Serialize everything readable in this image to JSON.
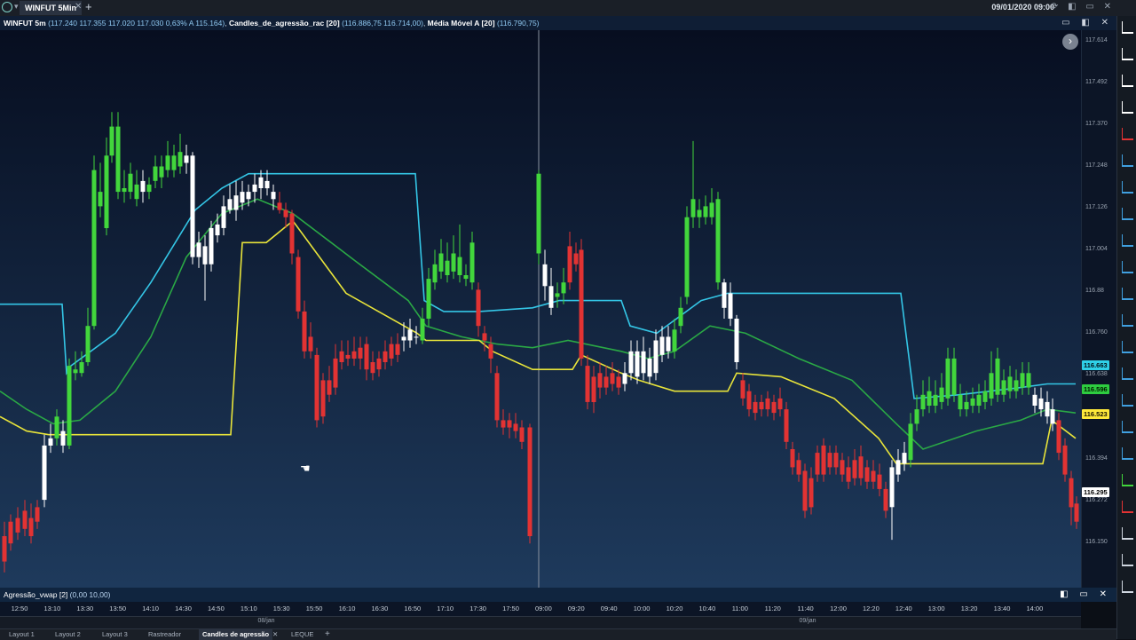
{
  "window": {
    "tab_title": "WINFUT 5Min",
    "datetime": "09/01/2020 09:00",
    "tab_close": "✕",
    "tab_add": "+"
  },
  "chart_header": {
    "symbol": "WINFUT 5m",
    "ohlc": "(117.240  117.355  117.020  117.030  0,63%  A 115.164)",
    "indicator1": "Candles_de_agressão_rac [20]",
    "indicator1_values": "(116.886,75  116.714,00)",
    "indicator2": "Média Móvel A [20]",
    "indicator2_values": "(116.790,75)"
  },
  "price_axis": {
    "ticks": [
      "117.614",
      "117.492",
      "117.370",
      "117.248",
      "117.126",
      "117.004",
      "116.88",
      "116.760",
      "116.638",
      "116.394",
      "116.272",
      "116.150"
    ],
    "badges": [
      {
        "value": "116.663",
        "color": "#2fd0e8",
        "text_color": "#001018"
      },
      {
        "value": "116.596",
        "color": "#2ecc40",
        "text_color": "#001a00"
      },
      {
        "value": "116.523",
        "color": "#ffe93a",
        "text_color": "#1a1400"
      },
      {
        "value": "116.295",
        "color": "#ffffff",
        "text_color": "#000000"
      }
    ]
  },
  "time_axis": {
    "ticks": [
      "12:50",
      "13:10",
      "13:30",
      "13:50",
      "14:10",
      "14:30",
      "14:50",
      "15:10",
      "15:30",
      "15:50",
      "16:10",
      "16:30",
      "16:50",
      "17:10",
      "17:30",
      "17:50",
      "09:00",
      "09:20",
      "09:40",
      "10:00",
      "10:20",
      "10:40",
      "11:00",
      "11:20",
      "11:40",
      "12:00",
      "12:20",
      "12:40",
      "13:00",
      "13:20",
      "13:40",
      "14:00"
    ],
    "dates": [
      "08/jan",
      "09/jan"
    ]
  },
  "sub_panel": {
    "title": "Agressão_vwap [2]",
    "values": "(0,00 10,00)"
  },
  "bottom_tabs": [
    "Layout 1",
    "Layout 2",
    "Layout 3",
    "Rastreador",
    "Candles de agressão",
    "LEQUE"
  ],
  "bottom_tab_close": "✕",
  "bottom_tab_add": "+",
  "colors": {
    "cyan_band": "#34c6e6",
    "yellow_line": "#e8e43a",
    "green_line": "#2aa845",
    "bull": "#42d63c",
    "bear": "#e23333",
    "neutral": "#ffffff"
  },
  "chart_data": {
    "type": "candlestick",
    "symbol": "WINFUT 5m",
    "ylim": [
      116.108,
      117.646
    ],
    "series": [
      {
        "name": "Candles_de_agressão_rac [20]",
        "values": [
          116.886,
          116.714
        ]
      },
      {
        "name": "Média Móvel A [20]",
        "values": [
          116.791
        ]
      }
    ],
    "last_values": {
      "cyan": 116.663,
      "green": 116.596,
      "yellow": 116.523,
      "price": 116.295
    }
  }
}
